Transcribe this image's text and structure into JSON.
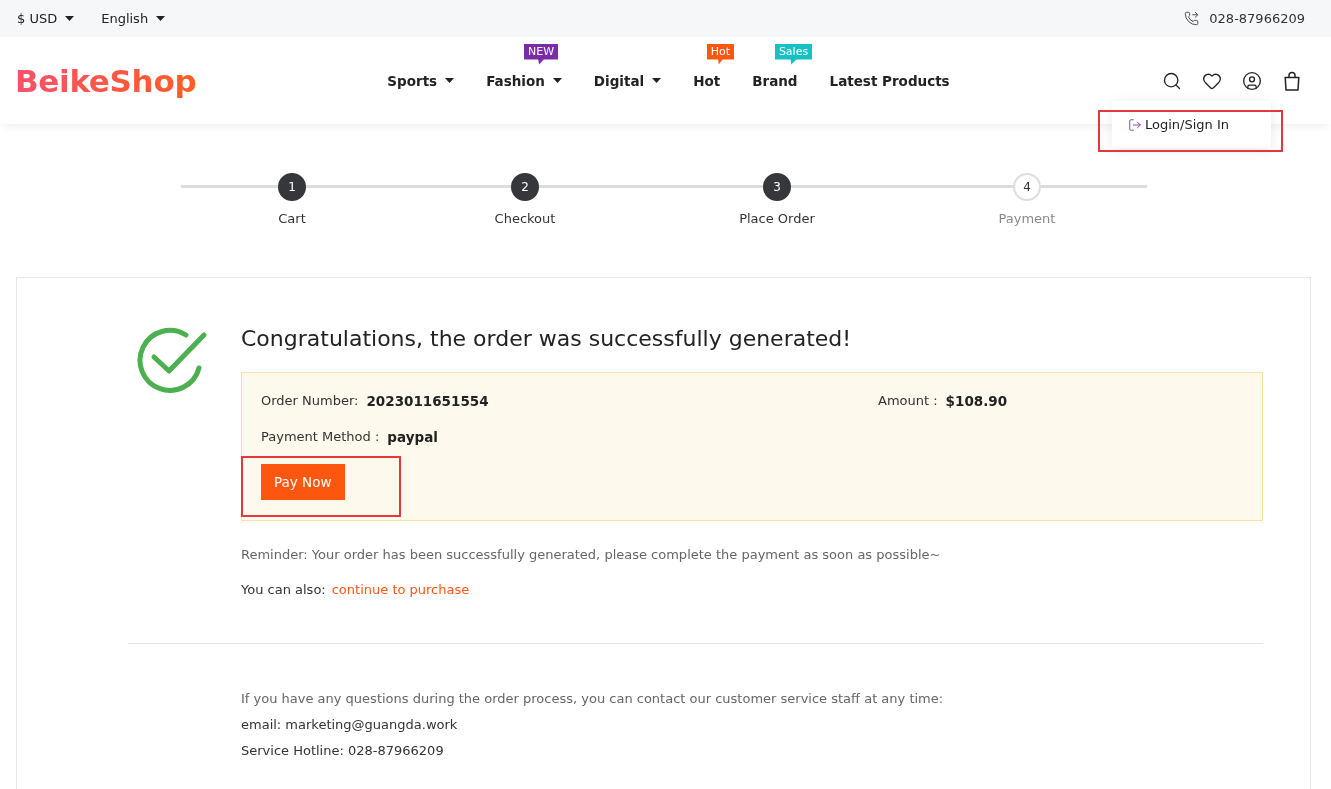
{
  "top_bar": {
    "currency": "$ USD",
    "language": "English",
    "phone": "028-87966209"
  },
  "header": {
    "logo": "BeikeShop",
    "nav": [
      {
        "label": "Sports",
        "dropdown": true
      },
      {
        "label": "Fashion",
        "dropdown": true,
        "badge": {
          "text": "NEW",
          "color": "#7b2aa8"
        }
      },
      {
        "label": "Digital",
        "dropdown": true
      },
      {
        "label": "Hot",
        "dropdown": false,
        "badge": {
          "text": "Hot",
          "color": "#fd560f"
        }
      },
      {
        "label": "Brand",
        "dropdown": false,
        "badge": {
          "text": "Sales",
          "color": "#16c1c3"
        }
      },
      {
        "label": "Latest Products",
        "dropdown": false
      }
    ],
    "account_menu": {
      "open": true,
      "items": [
        {
          "label": "Login/Sign In",
          "highlighted": true
        }
      ]
    }
  },
  "steps": [
    {
      "number": "1",
      "label": "Cart",
      "completed": true
    },
    {
      "number": "2",
      "label": "Checkout",
      "completed": true
    },
    {
      "number": "3",
      "label": "Place Order",
      "completed": true
    },
    {
      "number": "4",
      "label": "Payment",
      "completed": false
    }
  ],
  "order": {
    "title": "Congratulations, the order was successfully generated!",
    "fields": [
      {
        "label": "Order Number:",
        "value": "2023011651554"
      },
      {
        "label": "Amount :",
        "value": "$108.90"
      },
      {
        "label": "Payment Method :",
        "value": "paypal"
      }
    ],
    "pay_button": {
      "label": "Pay Now",
      "highlighted": true
    },
    "reminder": "Reminder: Your order has been successfully generated, please complete the payment as soon as possible~",
    "also": {
      "label": "You can also:",
      "link": "continue to purchase"
    }
  },
  "contact": {
    "intro": "If you have any questions during the order process, you can contact our customer service staff at any time:",
    "email": "email: marketing@guangda.work",
    "hotline": "Service Hotline: 028-87966209"
  }
}
